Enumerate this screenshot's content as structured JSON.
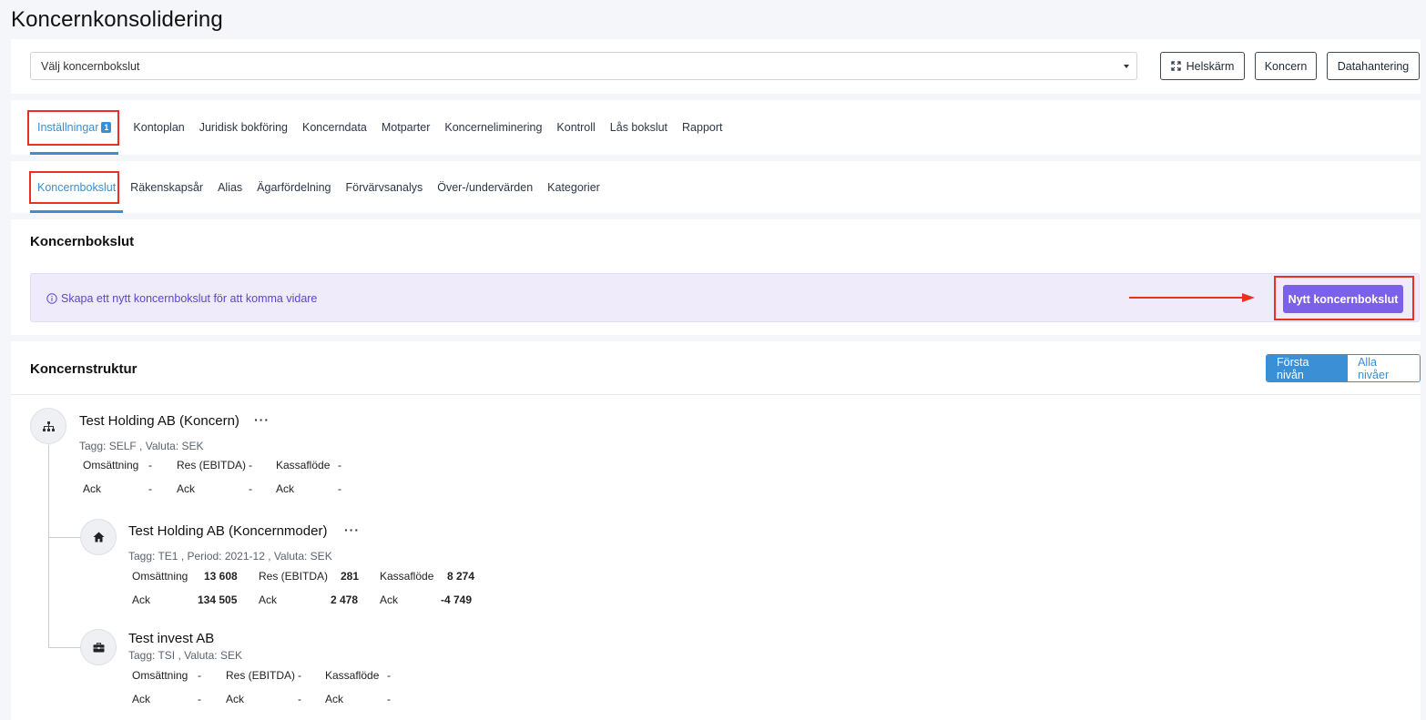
{
  "page": {
    "title": "Koncernkonsolidering"
  },
  "toolbar": {
    "select_value": "Välj koncernbokslut",
    "fullscreen_label": "Helskärm",
    "koncern_label": "Koncern",
    "datahantering_label": "Datahantering"
  },
  "main_tabs": [
    {
      "label": "Inställningar",
      "badge": "1",
      "active": true
    },
    {
      "label": "Kontoplan"
    },
    {
      "label": "Juridisk bokföring"
    },
    {
      "label": "Koncerndata"
    },
    {
      "label": "Motparter"
    },
    {
      "label": "Koncerneliminering"
    },
    {
      "label": "Kontroll"
    },
    {
      "label": "Lås bokslut"
    },
    {
      "label": "Rapport"
    }
  ],
  "sub_tabs": [
    {
      "label": "Koncernbokslut",
      "active": true
    },
    {
      "label": "Räkenskapsår"
    },
    {
      "label": "Alias"
    },
    {
      "label": "Ägarfördelning"
    },
    {
      "label": "Förvärvsanalys"
    },
    {
      "label": "Över-/undervärden"
    },
    {
      "label": "Kategorier"
    }
  ],
  "koncernbokslut": {
    "heading": "Koncernbokslut",
    "info_text": "Skapa ett nytt koncernbokslut för att komma vidare",
    "new_button": "Nytt koncernbokslut"
  },
  "koncernstruktur": {
    "heading": "Koncernstruktur",
    "level_first": "Första nivån",
    "level_all": "Alla nivåer",
    "nodes": [
      {
        "name": "Test Holding AB (Koncern)",
        "icon": "sitemap-icon",
        "meta": "Tagg: SELF , Valuta: SEK",
        "oms_label": "Omsättning",
        "oms_value": "-",
        "res_label": "Res (EBITDA)",
        "res_value": "-",
        "kf_label": "Kassaflöde",
        "kf_value": "-",
        "ack_label": "Ack",
        "ack_oms": "-",
        "ack_res": "-",
        "ack_kf": "-"
      },
      {
        "name": "Test Holding AB (Koncernmoder)",
        "icon": "home-icon",
        "meta": "Tagg: TE1 , Period: 2021-12 , Valuta: SEK",
        "oms_label": "Omsättning",
        "oms_value": "13 608",
        "res_label": "Res (EBITDA)",
        "res_value": "281",
        "kf_label": "Kassaflöde",
        "kf_value": "8 274",
        "ack_label": "Ack",
        "ack_oms": "134 505",
        "ack_res": "2 478",
        "ack_kf": "-4 749"
      },
      {
        "name": "Test invest AB",
        "icon": "briefcase-icon",
        "meta": "Tagg: TSI , Valuta: SEK",
        "oms_label": "Omsättning",
        "oms_value": "-",
        "res_label": "Res (EBITDA)",
        "res_value": "-",
        "kf_label": "Kassaflöde",
        "kf_value": "-",
        "ack_label": "Ack",
        "ack_oms": "-",
        "ack_res": "-",
        "ack_kf": "-"
      }
    ]
  },
  "colors": {
    "accent": "#3b8fd4",
    "purple": "#7b61e8",
    "highlight_red": "#e8321f"
  }
}
